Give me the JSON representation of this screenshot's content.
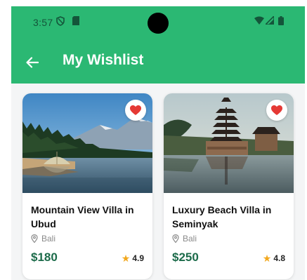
{
  "status_bar": {
    "time": "3:57",
    "icons": [
      "shield-icon",
      "sim-card-icon",
      "wifi-icon",
      "signal-icon",
      "battery-icon"
    ]
  },
  "app_bar": {
    "title": "My Wishlist",
    "back_icon": "arrow-left-icon"
  },
  "wishlist": [
    {
      "name": "Mountain View Villa in Ubud",
      "location": "Bali",
      "price": "$180",
      "rating": "4.9",
      "favorite": true
    },
    {
      "name": "Luxury Beach Villa in Seminyak",
      "location": "Bali",
      "price": "$250",
      "rating": "4.8",
      "favorite": true
    }
  ],
  "colors": {
    "primary": "#2bb873",
    "price": "#1c6b4a",
    "heart": "#e53935",
    "star": "#f2a81e"
  }
}
